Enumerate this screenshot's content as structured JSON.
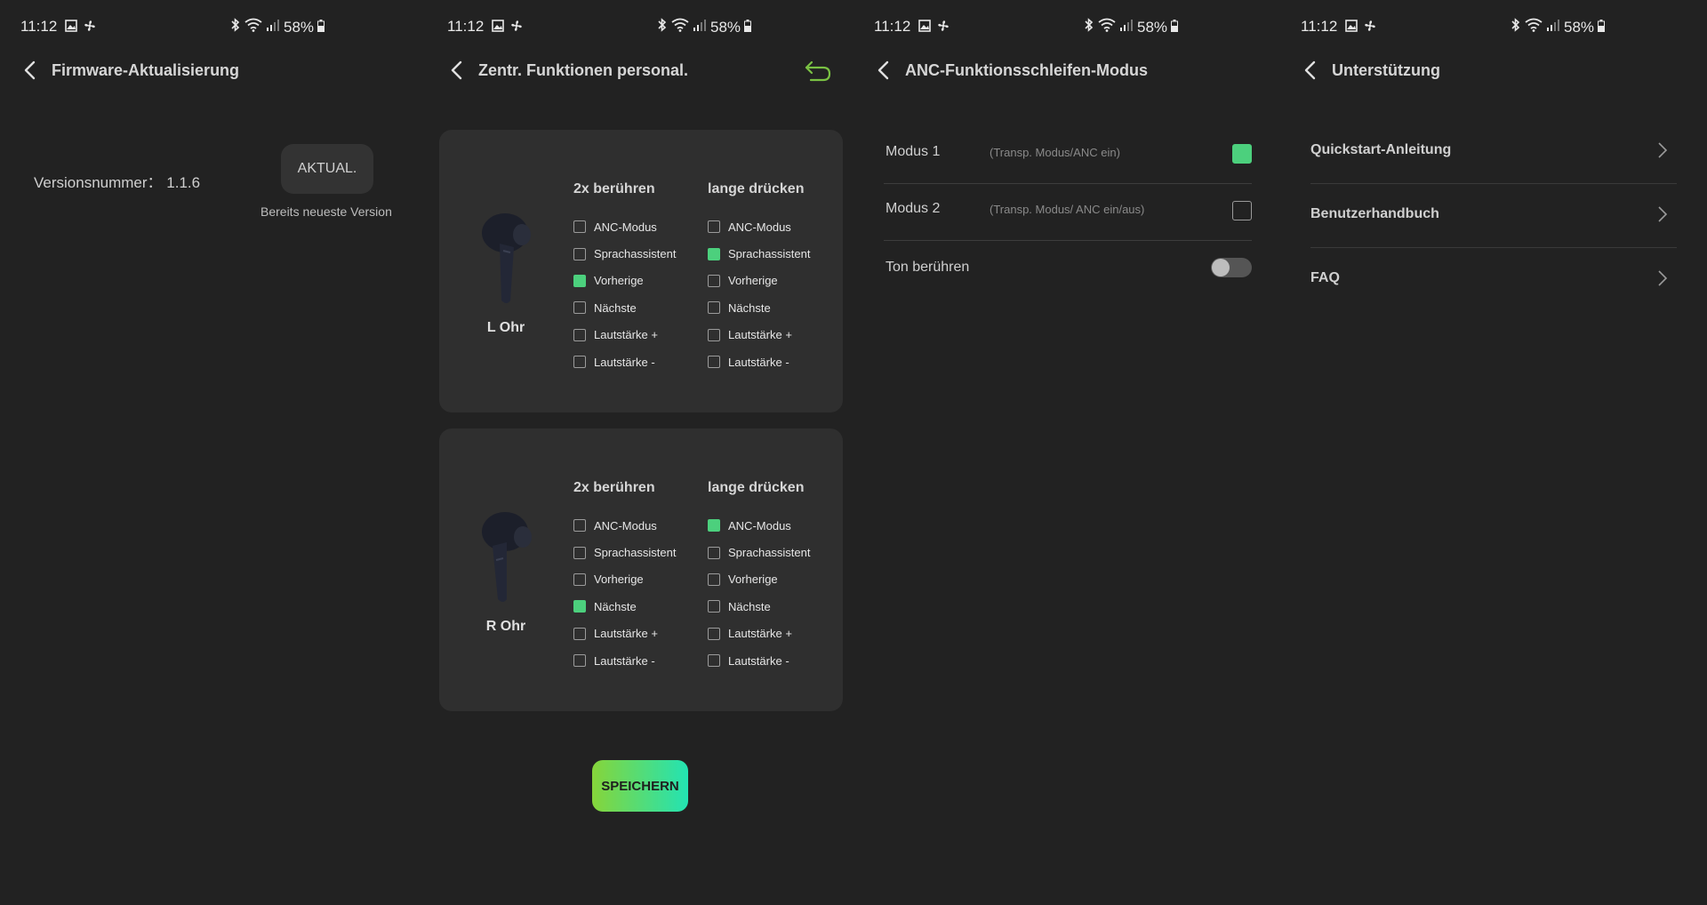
{
  "status": {
    "time": "11:12",
    "battery": "58%"
  },
  "panel1": {
    "title": "Firmware-Aktualisierung",
    "version_label": "Versionsnummer：",
    "version_value": "1.1.6",
    "update_button": "AKTUAL.",
    "latest_text": "Bereits neueste Version"
  },
  "panel2": {
    "title": "Zentr. Funktionen personal.",
    "col_touch": "2x berühren",
    "col_long": "lange drücken",
    "options": [
      "ANC-Modus",
      "Sprachassistent",
      "Vorherige",
      "Nächste",
      "Lautstärke +",
      "Lautstärke -"
    ],
    "left": {
      "label": "L Ohr",
      "touch_checked": "Vorherige",
      "long_checked": "Sprachassistent"
    },
    "right": {
      "label": "R Ohr",
      "touch_checked": "Nächste",
      "long_checked": "ANC-Modus"
    },
    "save_button": "SPEICHERN"
  },
  "panel3": {
    "title": "ANC-Funktionsschleifen-Modus",
    "modes": [
      {
        "name": "Modus 1",
        "desc": "(Transp. Modus/ANC ein)",
        "checked": true
      },
      {
        "name": "Modus 2",
        "desc": "(Transp. Modus/ ANC ein/aus)",
        "checked": false
      }
    ],
    "ton_label": "Ton berühren",
    "ton_enabled": false
  },
  "panel4": {
    "title": "Unterstützung",
    "items": [
      "Quickstart-Anleitung",
      "Benutzerhandbuch",
      "FAQ"
    ]
  },
  "colors": {
    "background": "#222222",
    "card": "#2f2f2f",
    "accent_green": "#4cd07d",
    "undo_green": "#7ac143"
  },
  "icons": [
    "image-icon",
    "fan-icon",
    "bluetooth-icon",
    "wifi-icon",
    "signal-icon",
    "battery-icon",
    "back-arrow-icon",
    "undo-icon",
    "chevron-right-icon",
    "earbud-image"
  ]
}
